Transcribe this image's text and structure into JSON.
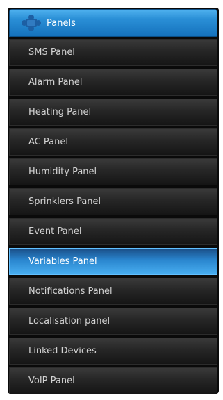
{
  "header": {
    "title": "Panels",
    "icon": "puzzle-icon"
  },
  "menu": {
    "items": [
      {
        "label": "SMS Panel"
      },
      {
        "label": "Alarm Panel"
      },
      {
        "label": "Heating Panel"
      },
      {
        "label": "AC Panel"
      },
      {
        "label": "Humidity Panel"
      },
      {
        "label": "Sprinklers Panel"
      },
      {
        "label": "Event Panel"
      },
      {
        "label": "Variables Panel",
        "active": true
      },
      {
        "label": "Notifications Panel"
      },
      {
        "label": "Localisation panel"
      },
      {
        "label": "Linked Devices"
      },
      {
        "label": "VoIP Panel"
      }
    ]
  },
  "colors": {
    "accent": "#2a8fd6",
    "item_background": "#262626",
    "item_text": "#d2d2d2"
  }
}
